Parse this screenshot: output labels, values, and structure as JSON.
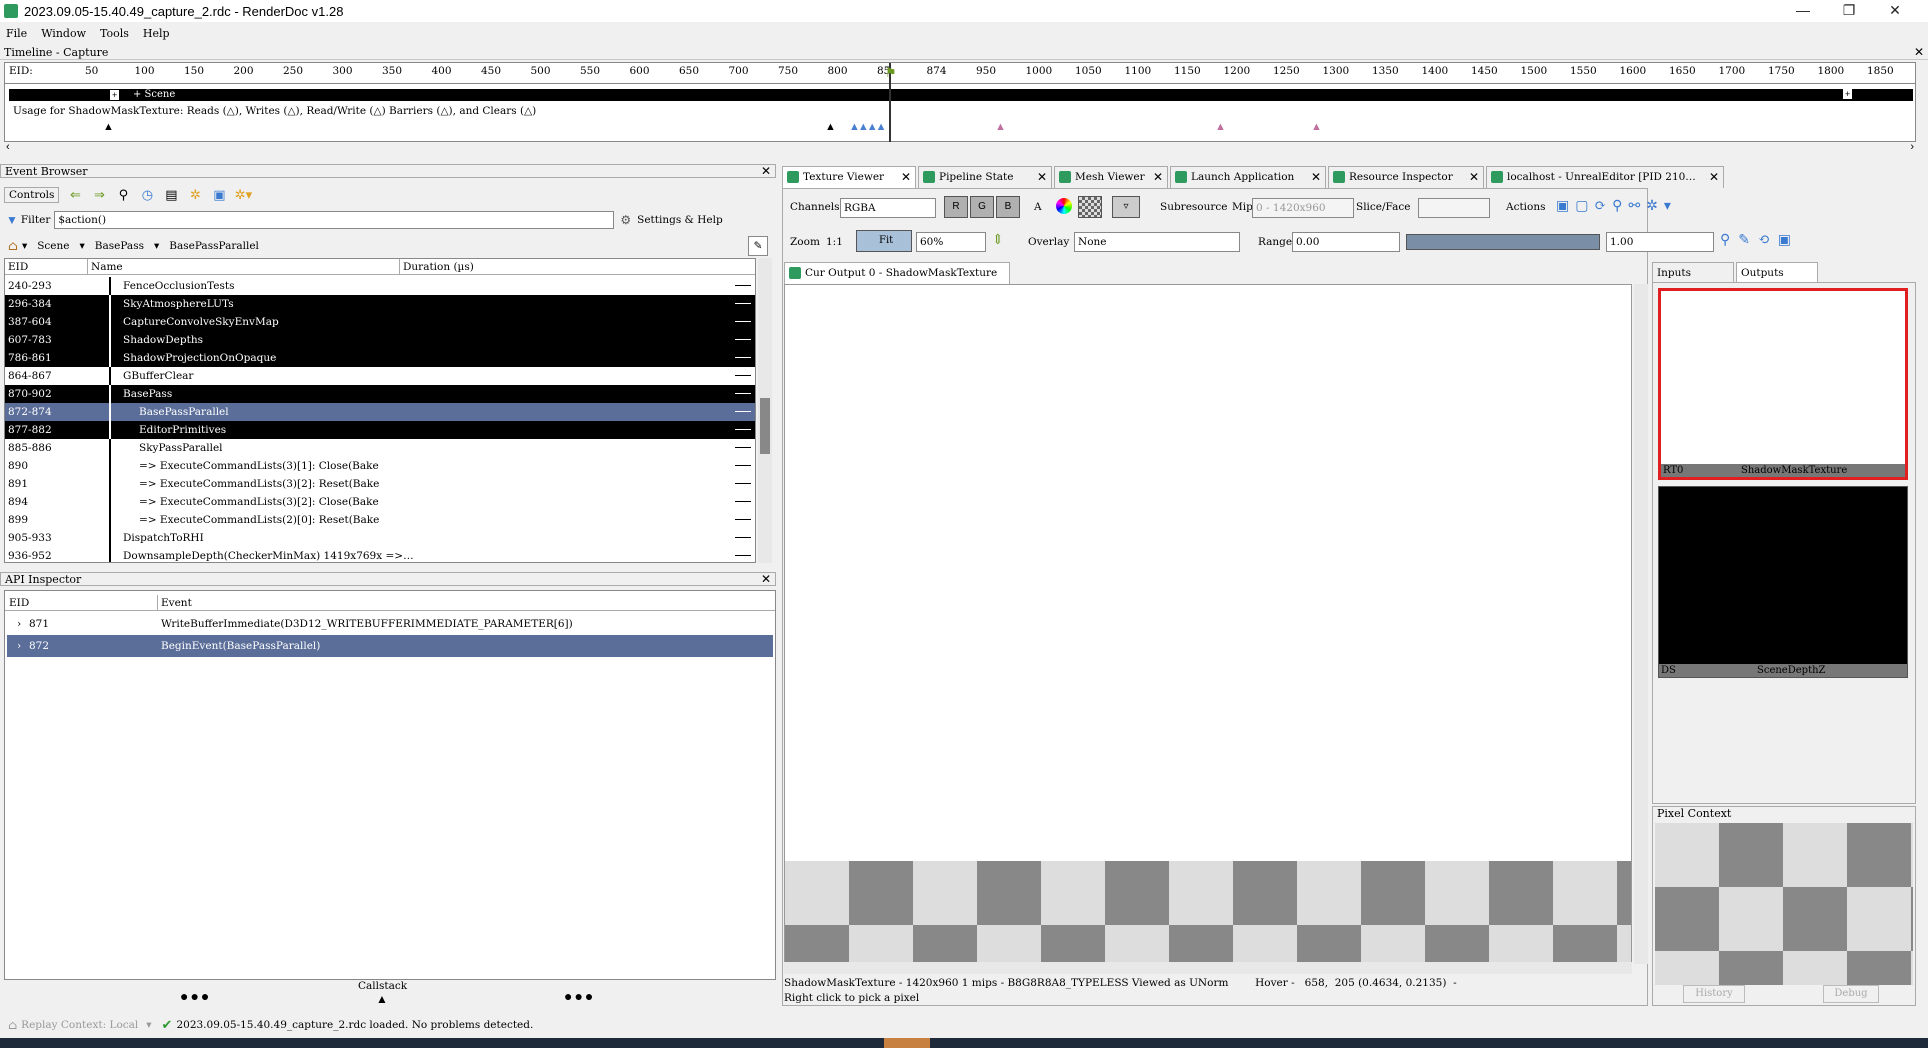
{
  "window": {
    "title": "2023.09.05-15.40.49_capture_2.rdc - RenderDoc v1.28",
    "minimize": "—",
    "maximize": "❐",
    "close": "✕"
  },
  "menu": [
    "File",
    "Window",
    "Tools",
    "Help"
  ],
  "timeline": {
    "header": "Timeline - Capture",
    "eid_label": "EID:",
    "ticks": [
      "50",
      "100",
      "150",
      "200",
      "250",
      "300",
      "350",
      "400",
      "450",
      "500",
      "550",
      "600",
      "650",
      "700",
      "750",
      "800",
      "85",
      "874",
      "950",
      "1000",
      "1050",
      "1100",
      "1150",
      "1200",
      "1250",
      "1300",
      "1350",
      "1400",
      "1450",
      "1500",
      "1550",
      "1600",
      "1650",
      "1700",
      "1750",
      "1800",
      "1850"
    ],
    "scene_label": "+ Scene",
    "usage": "Usage for ShadowMaskTexture: Reads (△), Writes (△), Read/Write (△) Barriers (△), and Clears (△)"
  },
  "event_browser": {
    "header": "Event Browser",
    "controls_label": "Controls",
    "filter_label": "Filter",
    "filter_value": "$action()",
    "settings_label": "Settings & Help",
    "breadcrumb": [
      "Scene",
      "BasePass",
      "BasePassParallel"
    ],
    "columns": [
      "EID",
      "Name",
      "Duration (µs)"
    ],
    "rows": [
      {
        "eid": "240-293",
        "name": "FenceOcclusionTests",
        "style": "normal",
        "indent": 1
      },
      {
        "eid": "296-384",
        "name": "SkyAtmosphereLUTs",
        "style": "dark",
        "indent": 1
      },
      {
        "eid": "387-604",
        "name": "CaptureConvolveSkyEnvMap",
        "style": "dark",
        "indent": 1
      },
      {
        "eid": "607-783",
        "name": "ShadowDepths",
        "style": "dark",
        "indent": 1
      },
      {
        "eid": "786-861",
        "name": "ShadowProjectionOnOpaque",
        "style": "dark",
        "indent": 1
      },
      {
        "eid": "864-867",
        "name": "GBufferClear",
        "style": "normal",
        "indent": 1
      },
      {
        "eid": "870-902",
        "name": "BasePass",
        "style": "dark",
        "indent": 1
      },
      {
        "eid": "872-874",
        "name": "BasePassParallel",
        "style": "sel",
        "indent": 2
      },
      {
        "eid": "877-882",
        "name": "EditorPrimitives",
        "style": "dark",
        "indent": 2
      },
      {
        "eid": "885-886",
        "name": "SkyPassParallel",
        "style": "normal",
        "indent": 2
      },
      {
        "eid": "890",
        "name": "=>  ExecuteCommandLists(3)[1]:  Close(Bake",
        "style": "normal",
        "indent": 2
      },
      {
        "eid": "891",
        "name": "=>  ExecuteCommandLists(3)[2]:  Reset(Bake",
        "style": "normal",
        "indent": 2
      },
      {
        "eid": "894",
        "name": "=>  ExecuteCommandLists(3)[2]:  Close(Bake",
        "style": "normal",
        "indent": 2
      },
      {
        "eid": "899",
        "name": "=>  ExecuteCommandLists(2)[0]:  Reset(Bake",
        "style": "normal",
        "indent": 2
      },
      {
        "eid": "905-933",
        "name": "DispatchToRHI",
        "style": "normal",
        "indent": 1
      },
      {
        "eid": "936-952",
        "name": "DownsampleDepth(CheckerMinMax) 1419x769x =>…",
        "style": "normal",
        "indent": 1
      }
    ]
  },
  "api_inspector": {
    "header": "API Inspector",
    "columns": [
      "EID",
      "Event"
    ],
    "rows": [
      {
        "eid": "871",
        "event": "WriteBufferImmediate(D3D12_WRITEBUFFERIMMEDIATE_PARAMETER[6])"
      },
      {
        "eid": "872",
        "event": "BeginEvent(BasePassParallel)"
      }
    ],
    "callstack_label": "Callstack"
  },
  "tabs": [
    {
      "label": "Texture Viewer",
      "active": true
    },
    {
      "label": "Pipeline State",
      "active": false
    },
    {
      "label": "Mesh Viewer",
      "active": false
    },
    {
      "label": "Launch Application",
      "active": false
    },
    {
      "label": "Resource Inspector",
      "active": false
    },
    {
      "label": "localhost - UnrealEditor [PID 210…",
      "active": false
    }
  ],
  "texture_viewer": {
    "channels_label": "Channels",
    "channels_value": "RGBA",
    "channel_buttons": [
      "R",
      "G",
      "B",
      "A"
    ],
    "subresource_label": "Subresource",
    "mip_label": "Mip",
    "mip_value": "0 - 1420x960",
    "slice_label": "Slice/Face",
    "actions_label": "Actions",
    "zoom_label": "Zoom",
    "zoom_1to1": "1:1",
    "fit_label": "Fit",
    "zoom_value": "60%",
    "overlay_label": "Overlay",
    "overlay_value": "None",
    "range_label": "Range",
    "range_min": "0.00",
    "range_max": "1.00",
    "output_tab": "Cur Output 0 - ShadowMaskTexture",
    "status_line": "ShadowMaskTexture - 1420x960 1 mips - B8G8R8A8_TYPELESS Viewed as UNorm        Hover -   658,  205 (0.4634, 0.2135)  -",
    "status_line2": "Right click to pick a pixel"
  },
  "side_panel": {
    "tabs": [
      "Inputs",
      "Outputs"
    ],
    "thumbs": [
      {
        "slot": "RT0",
        "name": "ShadowMaskTexture"
      },
      {
        "slot": "DS",
        "name": "SceneDepthZ"
      }
    ],
    "pixel_context_header": "Pixel Context",
    "history_btn": "History",
    "debug_btn": "Debug"
  },
  "status_bar": {
    "replay_context": "Replay Context: Local",
    "message": "2023.09.05-15.40.49_capture_2.rdc loaded. No problems detected."
  },
  "colors": {
    "selection": "#5b6e9a",
    "accent_green": "#2e9a5e",
    "highlight_red": "#e02020"
  }
}
